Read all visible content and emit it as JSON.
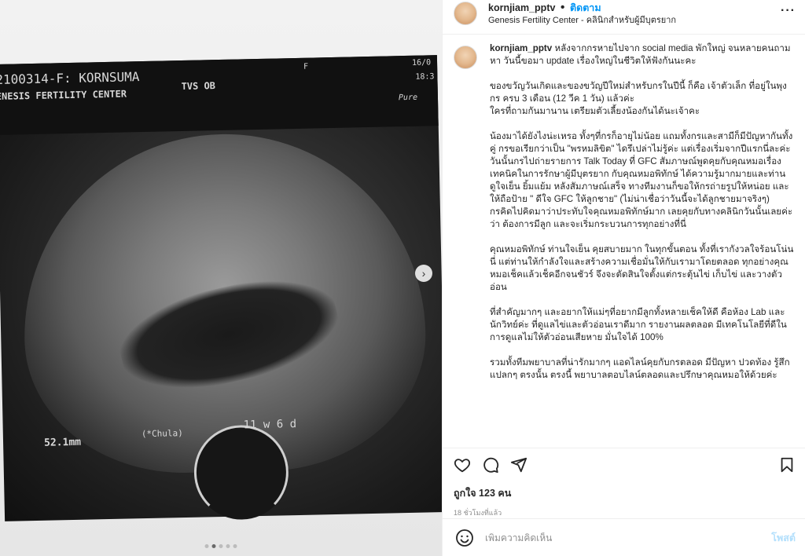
{
  "post": {
    "username": "kornjiam_pptv",
    "follow_label": "ติดตาม",
    "location": "Genesis Fertility Center - คลินิกสำหรับผู้มีบุตรยาก",
    "more_icon": "more-horizontal-icon"
  },
  "media": {
    "scan_id": "2100314-F: KORNSUMA",
    "clinic": "ENESIS FERTILITY CENTER",
    "mode": "TVS OB",
    "flag": "F",
    "date": "16/0",
    "time": "18:3",
    "brand": "Pure",
    "measure": "52.1mm",
    "marker": "(*Chula)",
    "ga": "11 w 6 d",
    "carousel_count": 5,
    "carousel_active": 2
  },
  "caption": {
    "username": "kornjiam_pptv",
    "paragraphs": [
      "หลังจากกรหายไปจาก social media พักใหญ่ จนหลายคนถามหา วันนี้ขอมา update เรื่องใหญ่ในชีวิตให้ฟังกันนะคะ",
      "ของขวัญวันเกิดและของขวัญปีใหม่สำหรับกรในปีนี้ ก็คือ เจ้าตัวเล็ก ที่อยู่ในพุงกร ครบ 3 เดือน (12 วีค 1 วัน) แล้วค่ะ\nใครที่ถามกันมานาน เตรียมตัวเลี้ยงน้องกันได้นะเจ้าคะ",
      "น้องมาได้ยังไงน่ะเหรอ ทั้งๆที่กรก็อายุไม่น้อย แถมทั้งกรและสามีก็มีปัญหากันทั้งคู่ กรขอเรียกว่าเป็น \"พรหมลิขิต\" ไดรึเปล่าไม่รู้ค่ะ แต่เรื่องเริ่มจากปีแรกนี่ละค่ะ วันนั้นกรไปถ่ายรายการ Talk Today ที่ GFC สัมภาษณ์พูดคุยกับคุณหมอเรื่องเทคนิคในการรักษาผู้มีบุตรยาก กับคุณหมอพิทักษ์ ได้ความรู้มากมายและท่านดูใจเย็น ยิ้มแย้ม หลังสัมภาษณ์เสร็จ ทางทีมงานก็ขอให้กรถ่ายรูปให้หน่อย และให้ถือป้าย \" ดีใจ GFC ให้ลูกชาย\" (ไม่น่าเชื่อว่าวันนี้จะได้ลูกชายมาจริงๆ)\nกรคิดไปคิดมาว่าประทับใจคุณหมอพิทักษ์มาก เลยคุยกับทางคลินิกวันนั้นเลยค่ะ ว่า ต้องการมีลูก และจะเริ่มกระบวนการทุกอย่างที่นี่",
      "คุณหมอพิทักษ์ ท่านใจเย็น คุยสบายมาก ในทุกขั้นตอน ทั้งที่เรากังวลใจร้อนโน่นนี่ แต่ท่านให้กำลังใจและสร้างความเชื่อมั่นให้กับเรามาโดยตลอด ทุกอย่างคุณหมอเช็คแล้วเช็คอีกจนชัวร์ จึงจะตัดสินใจตั้งแต่กระตุ้นไข่ เก็บไข่ และวางตัวอ่อน",
      "ที่สำคัญมากๆ และอยากให้แม่ๆที่อยากมีลูกทั้งหลายเช็คให้ดี คือห้อง Lab และนักวิทย์ค่ะ ที่ดูแลไข่และตัวอ่อนเราดีมาก รายงานผลตลอด มีเทคโนโลยีที่ดีในการดูแลไม่ให้ตัวอ่อนเสียหาย มั่นใจได้ 100%",
      "รวมทั้งทีมพยาบาลที่น่ารักมากๆ แอดไลน์คุยกับกรตลอด มีปัญหา ปวดท้อง รู้สึกแปลกๆ ตรงนั้น ตรงนี้ พยาบาลตอบไลน์ตลอดและปรึกษาคุณหมอให้ด้วยค่ะ"
    ]
  },
  "actions": {
    "like_icon": "heart-icon",
    "comment_icon": "comment-icon",
    "share_icon": "share-icon",
    "save_icon": "bookmark-icon"
  },
  "likes_text": "ถูกใจ 123 คน",
  "time_text": "18 ชั่วโมงที่แล้ว",
  "comment_box": {
    "placeholder": "เพิ่มความคิดเห็น",
    "post_label": "โพสต์",
    "emoji_icon": "emoji-icon"
  },
  "colors": {
    "link_blue": "#0095f6",
    "post_disabled": "#b2dffc",
    "muted": "#8e8e8e"
  }
}
